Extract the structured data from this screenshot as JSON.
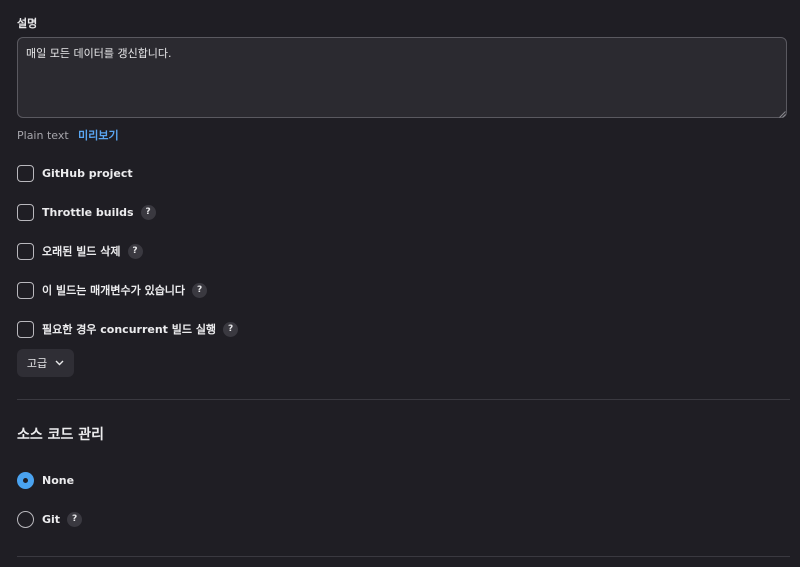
{
  "description": {
    "label": "설명",
    "value": "매일 모든 데이터를 갱신합니다.",
    "format_label": "Plain text",
    "preview_link": "미리보기"
  },
  "options": [
    {
      "label": "GitHub project",
      "checked": false,
      "help": false
    },
    {
      "label": "Throttle builds",
      "checked": false,
      "help": true
    },
    {
      "label": "오래된 빌드 삭제",
      "checked": false,
      "help": true
    },
    {
      "label": "이 빌드는 매개변수가 있습니다",
      "checked": false,
      "help": true
    },
    {
      "label": "필요한 경우 concurrent 빌드 실행",
      "checked": false,
      "help": true
    }
  ],
  "help_glyph": "?",
  "advanced_button": {
    "label": "고급",
    "icon": "chevron-down-icon"
  },
  "scm": {
    "title": "소스 코드 관리",
    "options": [
      {
        "label": "None",
        "selected": true,
        "help": false
      },
      {
        "label": "Git",
        "selected": false,
        "help": true
      }
    ]
  },
  "colors": {
    "background": "#1f1e24",
    "accent": "#4aa3f0",
    "link": "#5aa6f2"
  }
}
